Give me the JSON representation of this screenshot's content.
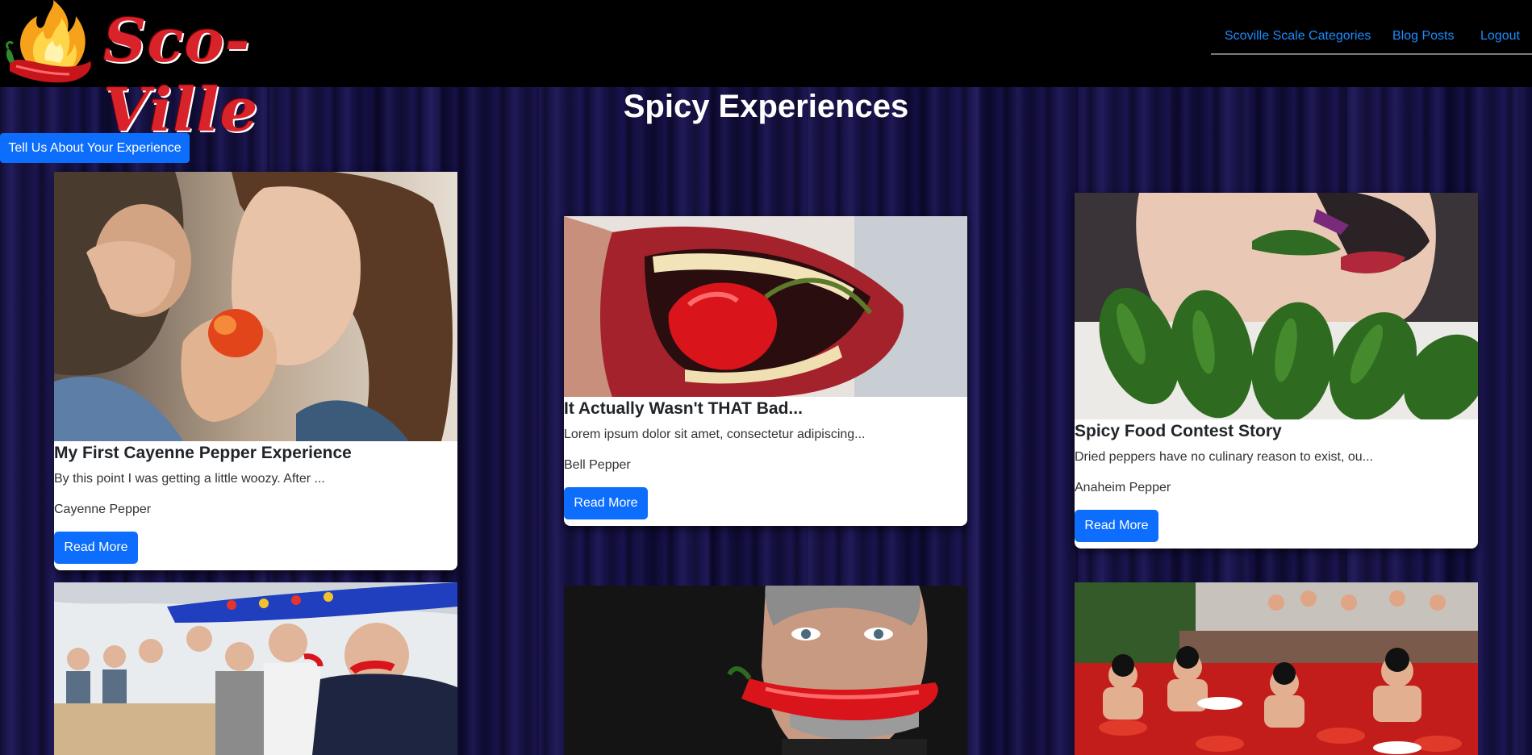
{
  "brand": {
    "name": "Sco-Ville"
  },
  "nav": {
    "items": [
      {
        "label": "Scoville Scale Categories"
      },
      {
        "label": "Blog Posts"
      },
      {
        "label": "Logout"
      }
    ]
  },
  "page": {
    "title": "Spicy Experiences",
    "share_button": "Tell Us About Your Experience"
  },
  "posts": [
    {
      "title": "My First Cayenne Pepper Experience",
      "excerpt": "By this point I was getting a little woozy. After ...",
      "pepper": "Cayenne Pepper",
      "button": "Read More"
    },
    {
      "title": "It Actually Wasn't THAT Bad...",
      "excerpt": "Lorem ipsum dolor sit amet, consectetur adipiscing...",
      "pepper": "Bell Pepper",
      "button": "Read More"
    },
    {
      "title": "Spicy Food Contest Story",
      "excerpt": "Dried peppers have no culinary reason to exist, ou...",
      "pepper": "Anaheim Pepper",
      "button": "Read More"
    }
  ],
  "colors": {
    "primary": "#0d6efd",
    "nav_link": "#1a8cff",
    "brand_red": "#d8232a",
    "background": "#141043"
  }
}
